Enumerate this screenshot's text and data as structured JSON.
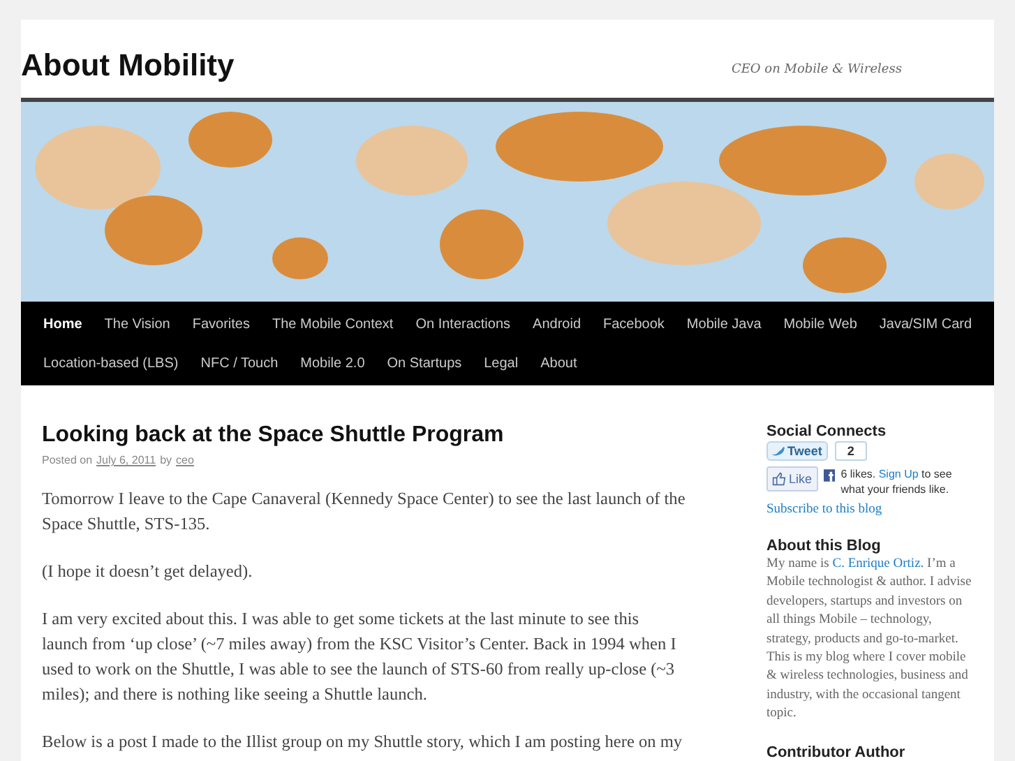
{
  "site": {
    "title": "About Mobility",
    "tagline": "CEO on Mobile & Wireless"
  },
  "nav": [
    {
      "label": "Home",
      "selected": true
    },
    {
      "label": "The Vision",
      "selected": false
    },
    {
      "label": "Favorites",
      "selected": false
    },
    {
      "label": "The Mobile Context",
      "selected": false
    },
    {
      "label": "On Interactions",
      "selected": false
    },
    {
      "label": "Android",
      "selected": false
    },
    {
      "label": "Facebook",
      "selected": false
    },
    {
      "label": "Mobile Java",
      "selected": false
    },
    {
      "label": "Mobile Web",
      "selected": false
    },
    {
      "label": "Java/SIM Card",
      "selected": false
    },
    {
      "label": "Location-based (LBS)",
      "selected": false
    },
    {
      "label": "NFC / Touch",
      "selected": false
    },
    {
      "label": "Mobile 2.0",
      "selected": false
    },
    {
      "label": "On Startups",
      "selected": false
    },
    {
      "label": "Legal",
      "selected": false
    },
    {
      "label": "About",
      "selected": false
    }
  ],
  "post": {
    "title": "Looking back at the Space Shuttle Program",
    "meta": {
      "prefix": "Posted on",
      "date": "July 6, 2011",
      "by": "by",
      "author": "ceo"
    },
    "paragraphs": [
      "Tomorrow I leave to the Cape Canaveral (Kennedy Space Center) to see the last launch of the Space Shuttle, STS-135.",
      "(I hope it doesn’t get delayed).",
      "I am very excited about this. I was able to get some tickets at the last minute to see this launch from ‘up close’ (~7 miles away) from the KSC Visitor’s Center. Back in 1994 when I used to work on the Shuttle, I was able to see the launch of STS-60 from really up-close (~3 miles); and there is nothing like seeing a Shuttle launch.",
      "Below is a post I made to the Illist group on my Shuttle story, which I am posting here on my"
    ]
  },
  "sidebar": {
    "social": {
      "heading": "Social Connects",
      "tweet": "Tweet",
      "tweet_count": "2",
      "like": "Like",
      "likes": "6 likes.",
      "signup": "Sign Up",
      "likes_rest": "to see what your friends like.",
      "subscribe": "Subscribe to this blog"
    },
    "about": {
      "heading": "About this Blog",
      "before": "My name is",
      "link": "C. Enrique Ortiz",
      "after": ". I’m a Mobile technologist & author. I advise developers, startups and investors on all things Mobile – technology, strategy, products and go-to-market. This is my blog where I cover mobile & wireless technologies, business and industry, with the occasional tangent topic."
    },
    "next_heading": "Contributor Author"
  }
}
